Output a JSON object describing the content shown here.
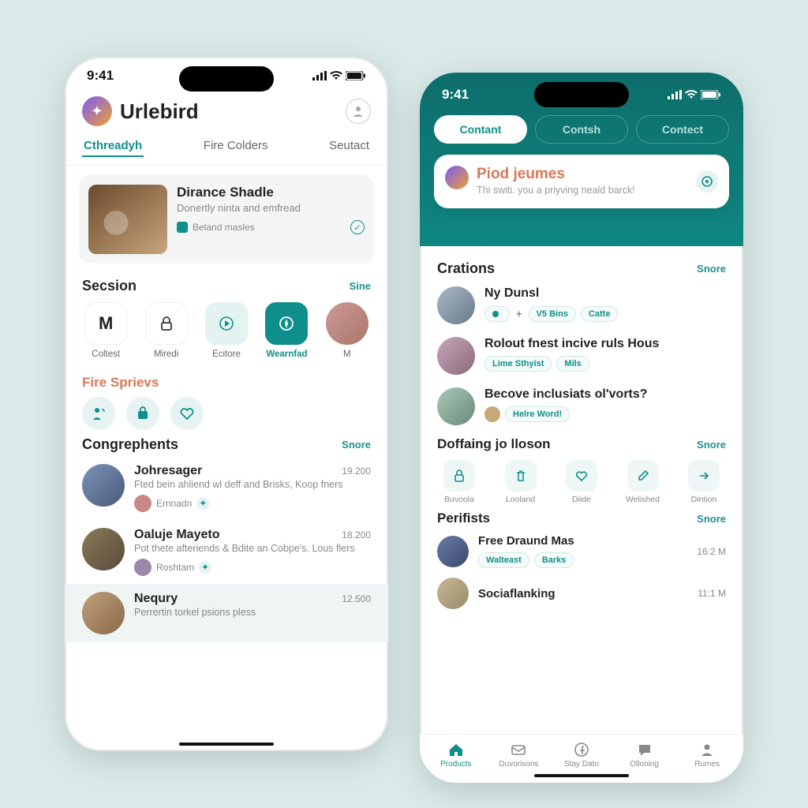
{
  "left": {
    "status_time": "9:41",
    "app_title": "Urlebird",
    "tabs": [
      "Cthreadyh",
      "Fire Colders",
      "Seutact"
    ],
    "featured": {
      "title": "Dirance Shadle",
      "subtitle": "Donertly ninta and emfread",
      "meta": "Beland masles"
    },
    "section1": {
      "header": "Secsion",
      "more": "Sine"
    },
    "categories": [
      {
        "label": "Coltest",
        "glyph": "M"
      },
      {
        "label": "Miredi",
        "glyph": "lock"
      },
      {
        "label": "Ecitore",
        "glyph": "play"
      },
      {
        "label": "Wearnfad",
        "glyph": "compass"
      },
      {
        "label": "M",
        "glyph": "avatar"
      }
    ],
    "section2_header": "Fire Sprievs",
    "section3": {
      "header": "Congrephents",
      "more": "Snore"
    },
    "posts": [
      {
        "name": "Johresager",
        "time": "19.200",
        "text": "Fted bein ahliend wl deff and Brisks, Koop fners",
        "meta": "Ernnadn"
      },
      {
        "name": "Oaluje Mayeto",
        "time": "18.200",
        "text": "Pot thete afteriends & Bdite an Cobpe's. Lous flers",
        "meta": "Roshtam"
      },
      {
        "name": "Nequry",
        "time": "12.500",
        "text": "Perrertin torkel psions pless",
        "meta": ""
      }
    ]
  },
  "right": {
    "status_time": "9:41",
    "tabs": [
      "Contant",
      "Contsh",
      "Contect"
    ],
    "hero": {
      "title": "Piod jeumes",
      "subtitle": "Thi switi. you a priyving neald barck!"
    },
    "crations": {
      "header": "Crations",
      "more": "Snore"
    },
    "crations_list": [
      {
        "name": "Ny Dunsl",
        "pills": [
          "V5 Bins",
          "Catte"
        ],
        "dot": true,
        "plus": true
      },
      {
        "name": "Rolout fnest incive ruls Hous",
        "pills": [
          "Lime Sthyist",
          "Mils"
        ]
      },
      {
        "name": "Becove inclusiats ol'vorts?",
        "pills": [
          "Helre Word!"
        ],
        "avatar_mini": true
      }
    ],
    "doffaing": {
      "header": "Doffaing jo lloson",
      "more": "Snore"
    },
    "actions": [
      {
        "label": "Buvoola",
        "icon": "lock"
      },
      {
        "label": "Looland",
        "icon": "trash"
      },
      {
        "label": "Diide",
        "icon": "heart"
      },
      {
        "label": "Welished",
        "icon": "edit"
      },
      {
        "label": "Dintion",
        "icon": "share"
      }
    ],
    "perifists": {
      "header": "Perifists",
      "more": "Snore"
    },
    "perifists_list": [
      {
        "name": "Free Draund Mas",
        "time": "16:2 M",
        "pills": [
          "Walteast",
          "Barks"
        ]
      },
      {
        "name": "Sociaflanking",
        "time": "11:1 M"
      }
    ],
    "nav": [
      {
        "label": "Products",
        "icon": "home",
        "active": true
      },
      {
        "label": "Duvorisons",
        "icon": "mail"
      },
      {
        "label": "Stay Dato",
        "icon": "fb"
      },
      {
        "label": "Olloning",
        "icon": "chat"
      },
      {
        "label": "Rumes",
        "icon": "user"
      }
    ]
  }
}
